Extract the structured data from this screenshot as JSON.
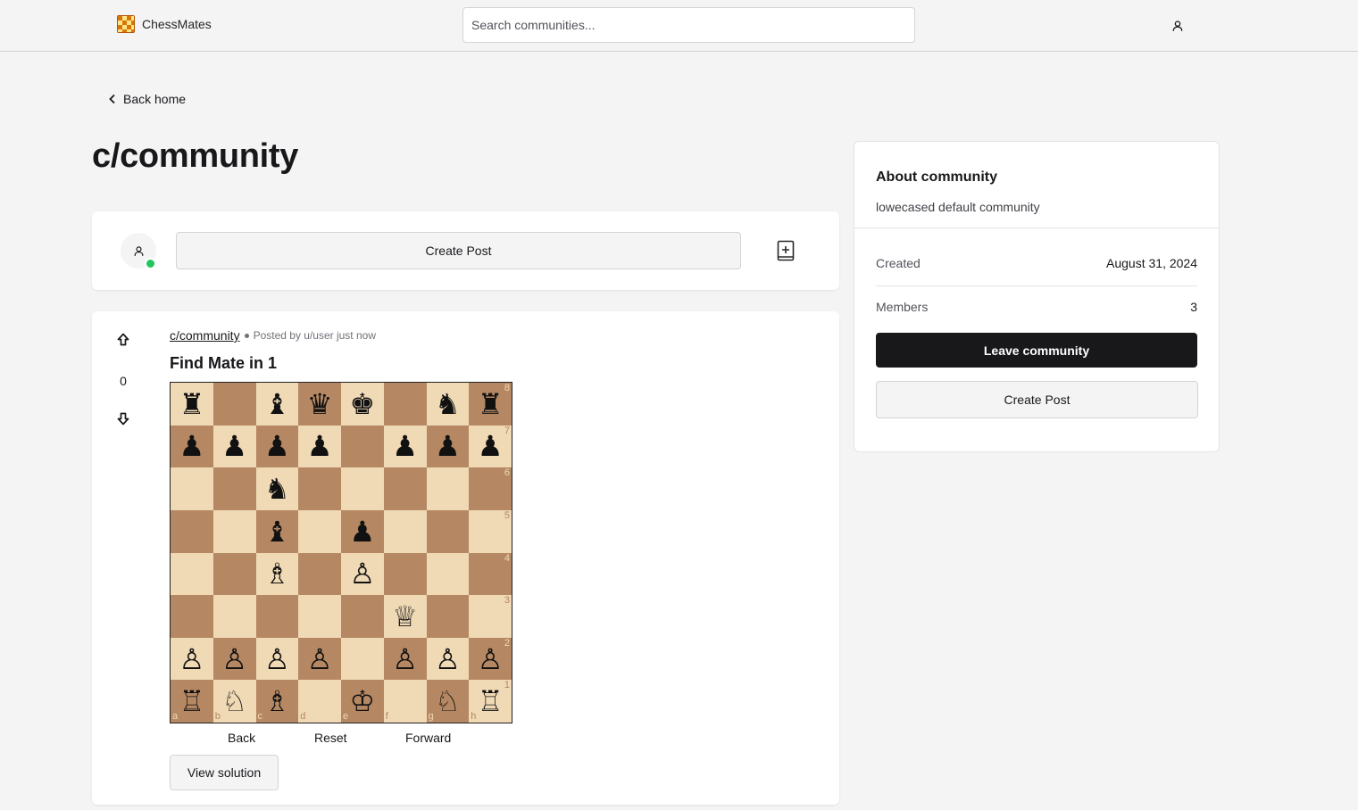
{
  "header": {
    "brand_name": "ChessMates",
    "search_placeholder": "Search communities..."
  },
  "nav": {
    "back_label": "Back home"
  },
  "page": {
    "title": "c/community"
  },
  "composer": {
    "create_post_label": "Create Post"
  },
  "post": {
    "subreddit": "c/community",
    "meta": "Posted by u/user just now",
    "votes": "0",
    "title": "Find Mate in 1",
    "controls": {
      "back": "Back",
      "reset": "Reset",
      "forward": "Forward"
    },
    "view_solution": "View solution",
    "board": {
      "files": [
        "a",
        "b",
        "c",
        "d",
        "e",
        "f",
        "g",
        "h"
      ],
      "ranks": [
        "8",
        "7",
        "6",
        "5",
        "4",
        "3",
        "2",
        "1"
      ],
      "rows": [
        [
          "♜",
          "",
          "♝",
          "♛",
          "♚",
          "",
          "♞",
          "♜"
        ],
        [
          "♟",
          "♟",
          "♟",
          "♟",
          "",
          "♟",
          "♟",
          "♟"
        ],
        [
          "",
          "",
          "♞",
          "",
          "",
          "",
          "",
          ""
        ],
        [
          "",
          "",
          "♝",
          "",
          "♟",
          "",
          "",
          ""
        ],
        [
          "",
          "",
          "♗",
          "",
          "♙",
          "",
          "",
          ""
        ],
        [
          "",
          "",
          "",
          "",
          "",
          "♕",
          "",
          ""
        ],
        [
          "♙",
          "♙",
          "♙",
          "♙",
          "",
          "♙",
          "♙",
          "♙"
        ],
        [
          "♖",
          "♘",
          "♗",
          "",
          "♔",
          "",
          "♘",
          "♖"
        ]
      ],
      "light_color": "#f0d9b5",
      "dark_color": "#b58863"
    }
  },
  "sidebar": {
    "title": "About community",
    "description": "lowecased default community",
    "created_label": "Created",
    "created_value": "August 31, 2024",
    "members_label": "Members",
    "members_value": "3",
    "leave_label": "Leave community",
    "create_post_label": "Create Post"
  },
  "colors": {
    "accent": "#18181b",
    "online": "#22c55e",
    "brand": "#b45309"
  },
  "icons": [
    "chessboard-logo-icon",
    "user-icon",
    "chevron-left-icon",
    "image-plus-icon",
    "arrow-up-icon",
    "arrow-down-icon"
  ]
}
